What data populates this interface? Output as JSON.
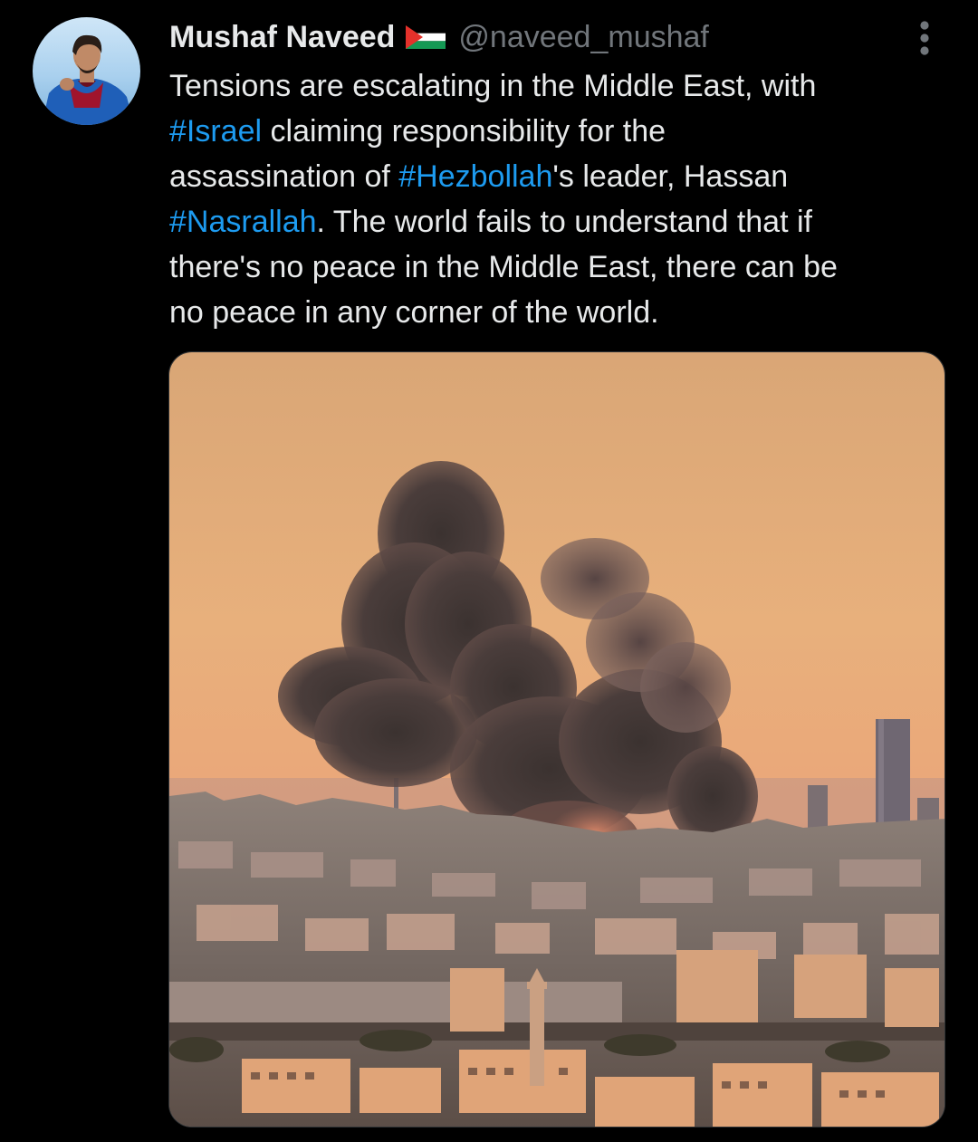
{
  "tweet": {
    "author": {
      "display_name": "Mushaf Naveed",
      "flag_icon": "palestine-flag-icon",
      "handle": "@naveed_mushaf"
    },
    "more_icon": "more-vertical-icon",
    "text_lines": [
      [
        {
          "t": "Tensions are escalating in the Middle East, with"
        }
      ],
      [
        {
          "t": "#Israel",
          "tag": true
        },
        {
          "t": " claiming responsibility for the"
        }
      ],
      [
        {
          "t": "assassination of "
        },
        {
          "t": "#Hezbollah",
          "tag": true
        },
        {
          "t": "'s leader, Hassan"
        }
      ],
      [
        {
          "t": "#Nasrallah",
          "tag": true
        },
        {
          "t": ". The world fails to understand that if"
        }
      ],
      [
        {
          "t": "there's no peace in the Middle East, there can be"
        }
      ],
      [
        {
          "t": "no peace in any corner of the world."
        }
      ]
    ],
    "media": {
      "type": "photo",
      "alt_icon": "city-smoke-photo"
    }
  },
  "colors": {
    "background": "#000000",
    "text": "#e7e9ea",
    "secondary": "#71767b",
    "hashtag": "#1d9bf0"
  }
}
